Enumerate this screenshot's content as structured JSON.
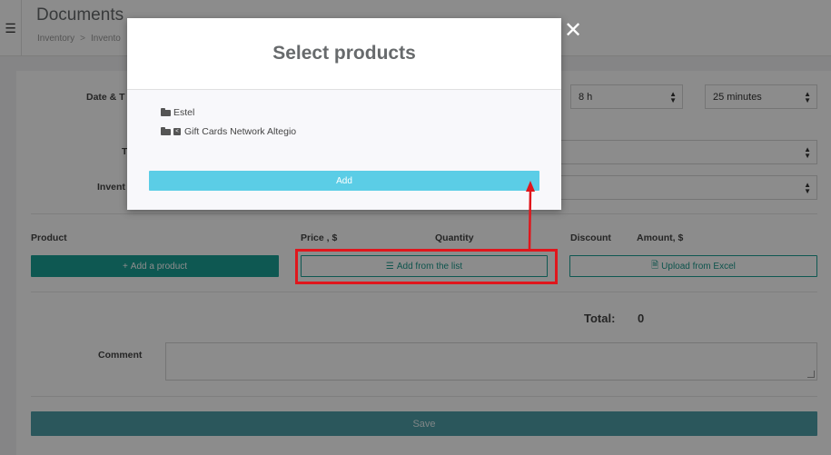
{
  "header": {
    "menu_icon": "hamburger-icon",
    "title": "Documents",
    "breadcrumb": [
      "Inventory",
      "Invento"
    ]
  },
  "form": {
    "date_time_label": "Date & T",
    "hours_value": "8 h",
    "minutes_value": "25 minutes",
    "type_label": "T",
    "inventory_label": "Invent",
    "columns": {
      "product": "Product",
      "price": "Price , $",
      "quantity": "Quantity",
      "discount": "Discount",
      "amount": "Amount, $"
    },
    "add_product_label": "Add a product",
    "add_from_list_label": "Add from the list",
    "upload_excel_label": "Upload from Excel",
    "total_label": "Total:",
    "total_value": "0",
    "comment_label": "Comment",
    "save_label": "Save"
  },
  "modal": {
    "title": "Select products",
    "items": [
      {
        "label": "Estel",
        "icon": "folder-icon"
      },
      {
        "label": "Gift Cards Network Altegio",
        "icon": "folder-icon"
      }
    ],
    "add_label": "Add",
    "close_icon": "close-icon"
  },
  "colors": {
    "teal": "#1aa095",
    "modal_add": "#5bcde6",
    "save": "#4f9ea8",
    "annotation": "#e0161c"
  }
}
